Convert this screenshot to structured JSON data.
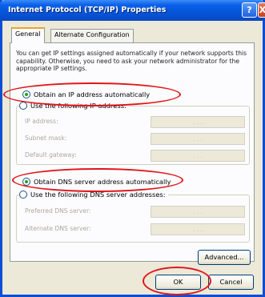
{
  "window": {
    "title": "Internet Protocol (TCP/IP) Properties",
    "help_label": "?",
    "close_label": "X"
  },
  "tabs": [
    {
      "label": "General",
      "active": true
    },
    {
      "label": "Alternate Configuration",
      "active": false
    }
  ],
  "description": "You can get IP settings assigned automatically if your network supports this capability. Otherwise, you need to ask your network administrator for the appropriate IP settings.",
  "ip": {
    "auto_label": "Obtain an IP address automatically",
    "manual_label": "Use the following IP address:",
    "selected": "auto",
    "fields": [
      {
        "label": "IP address:",
        "value": ". . ."
      },
      {
        "label": "Subnet mask:",
        "value": ". . ."
      },
      {
        "label": "Default gateway:",
        "value": ". . ."
      }
    ]
  },
  "dns": {
    "auto_label": "Obtain DNS server address automatically",
    "manual_label": "Use the following DNS server addresses:",
    "selected": "auto",
    "fields": [
      {
        "label": "Preferred DNS server:",
        "value": ". . ."
      },
      {
        "label": "Alternate DNS server:",
        "value": ". . ."
      }
    ]
  },
  "buttons": {
    "advanced": "Advanced...",
    "ok": "OK",
    "cancel": "Cancel"
  },
  "colors": {
    "highlight_ellipse": "#e0161b",
    "titlebar": "#0552d6",
    "dialog_bg": "#ece9d8"
  }
}
